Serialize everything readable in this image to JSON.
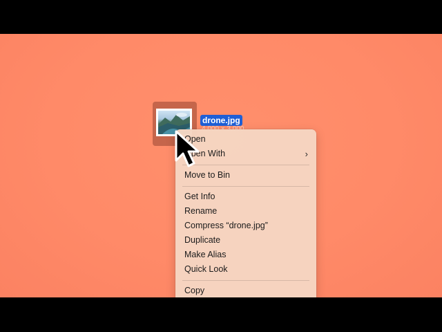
{
  "file": {
    "name": "drone.jpg",
    "dimensions": "4,000 × 3,000"
  },
  "menu": {
    "open": "Open",
    "open_with": "Open With",
    "move_to_bin": "Move to Bin",
    "get_info": "Get Info",
    "rename": "Rename",
    "compress": "Compress “drone.jpg”",
    "duplicate": "Duplicate",
    "make_alias": "Make Alias",
    "quick_look": "Quick Look",
    "copy": "Copy",
    "submenu_chevron": "›"
  },
  "colors": {
    "desktop": "#ff8a68",
    "selection": "#1f5fd6",
    "menu_bg": "#f6d6c2"
  },
  "icons": {
    "cursor": "arrow-pointer-icon",
    "thumbnail": "image-thumbnail-icon"
  }
}
